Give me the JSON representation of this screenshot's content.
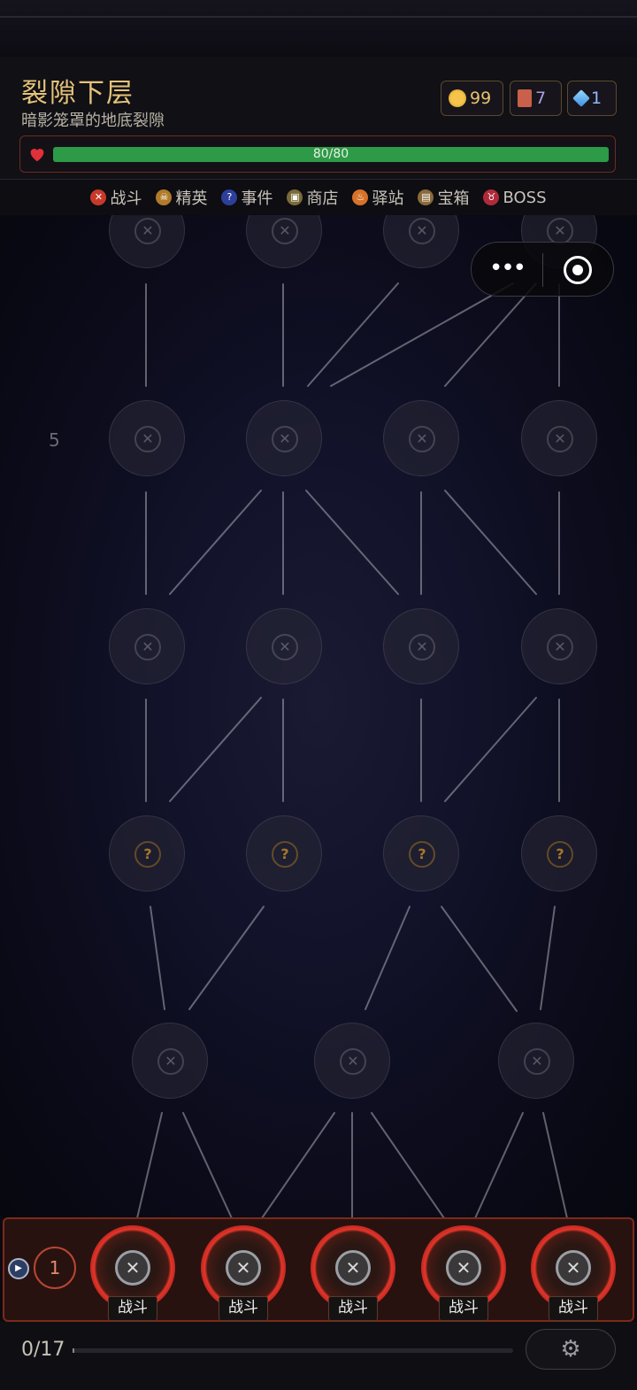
{
  "header": {
    "title": "裂隙下层",
    "subtitle": "暗影笼罩的地底裂隙",
    "resources": {
      "gold": "99",
      "cards": "7",
      "gems": "1"
    },
    "hp": {
      "text": "80/80",
      "current": 80,
      "max": 80
    }
  },
  "legend": [
    {
      "label": "战斗",
      "icon": "crossed-swords-icon",
      "color": "#c8392a"
    },
    {
      "label": "精英",
      "icon": "skull-icon",
      "color": "#b07a2a"
    },
    {
      "label": "事件",
      "icon": "question-icon",
      "color": "#2d3f9a"
    },
    {
      "label": "商店",
      "icon": "shop-cart-icon",
      "color": "#7a6a38"
    },
    {
      "label": "驿站",
      "icon": "campfire-icon",
      "color": "#d8722a"
    },
    {
      "label": "宝箱",
      "icon": "treasure-chest-icon",
      "color": "#8a6a3a"
    },
    {
      "label": "BOSS",
      "icon": "demon-icon",
      "color": "#b02a3a"
    }
  ],
  "map": {
    "floor_label": "5"
  },
  "choices": {
    "count": "1",
    "options": [
      {
        "label": "战斗"
      },
      {
        "label": "战斗"
      },
      {
        "label": "战斗"
      },
      {
        "label": "战斗"
      },
      {
        "label": "战斗"
      }
    ]
  },
  "footer": {
    "progress_text": "0/17",
    "progress": 0
  }
}
